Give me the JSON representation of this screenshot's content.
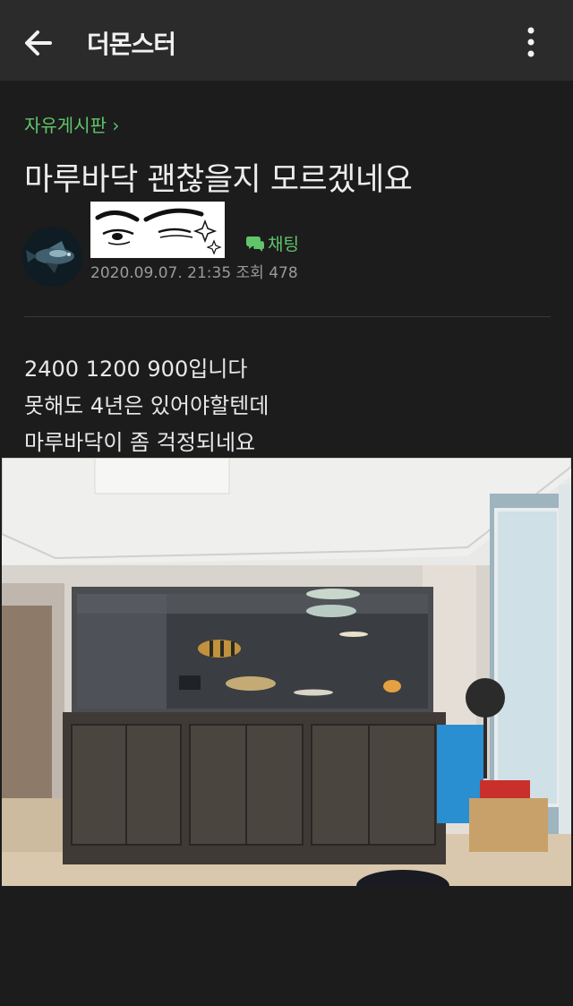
{
  "header": {
    "app_title": "더몬스터"
  },
  "post": {
    "board": "자유게시판 ›",
    "title": "마루바닥 괜찮을지 모르겠네요",
    "chat_label": "채팅",
    "meta": "2020.09.07. 21:35  조회 478",
    "body_lines": [
      "2400 1200 900입니다",
      "못해도 4년은 있어야할텐데",
      "마루바닥이 좀 걱정되네요"
    ]
  }
}
